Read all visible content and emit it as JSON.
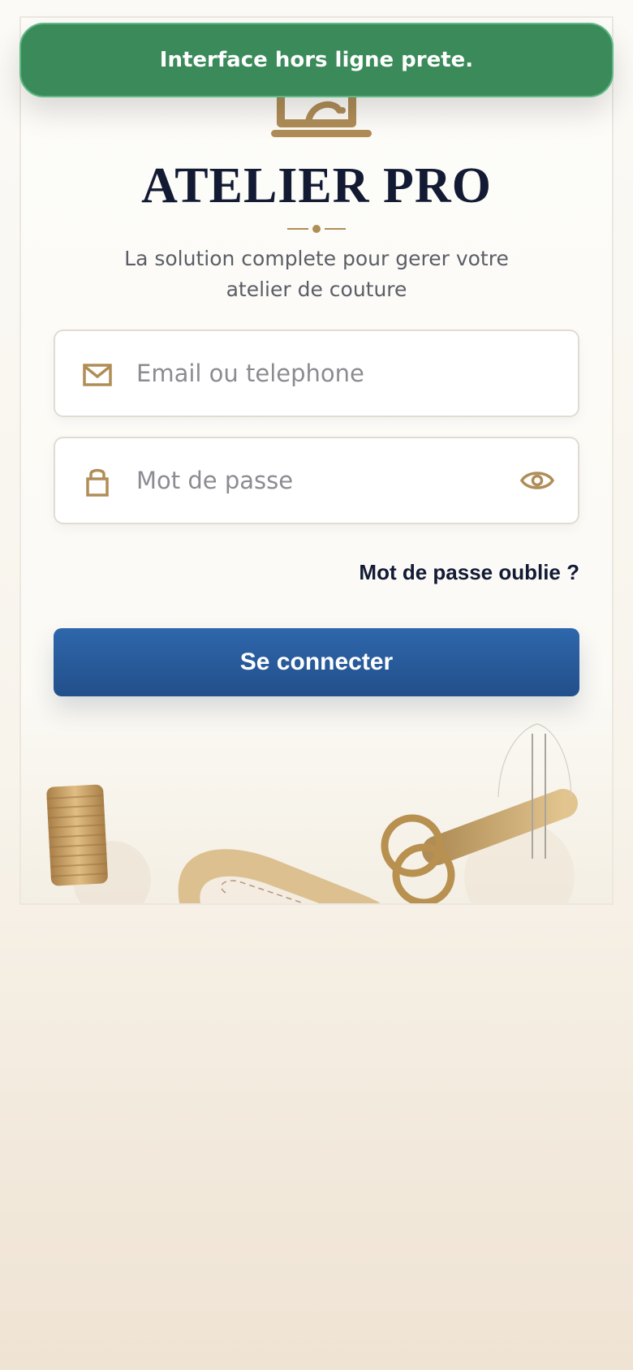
{
  "toast": {
    "message": "Interface hors ligne prete."
  },
  "brand": {
    "title": "ATELIER PRO",
    "subtitle": "La solution complete pour gerer votre atelier de couture",
    "accent_color": "#b08d57",
    "title_color": "#131a33"
  },
  "login_form": {
    "identifier": {
      "placeholder": "Email ou telephone",
      "value": "",
      "icon": "mail-icon"
    },
    "password": {
      "placeholder": "Mot de passe",
      "value": "",
      "icon": "lock-icon",
      "toggle_icon": "eye-icon"
    },
    "forgot_password_label": "Mot de passe oublie ?",
    "submit_label": "Se connecter",
    "submit_color": "#2a5c9c"
  },
  "toast_color": "#3a8a5a",
  "decoration": {
    "items": [
      "thread-spool-icon",
      "tape-measure-icon",
      "scissors-icon",
      "needle-icon"
    ]
  }
}
